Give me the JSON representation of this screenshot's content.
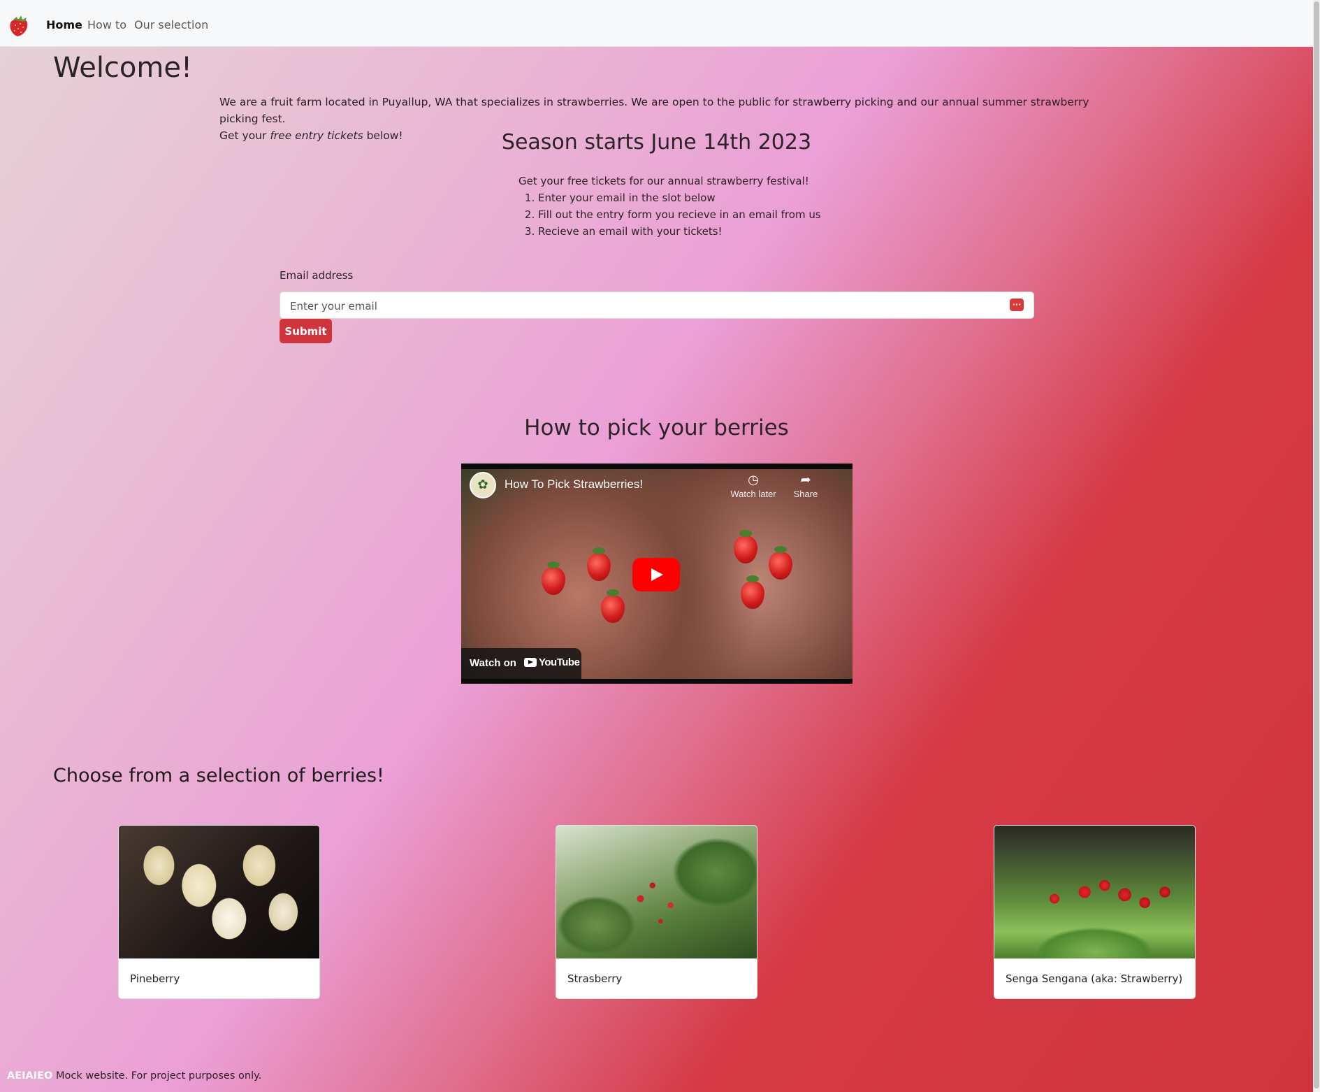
{
  "nav": {
    "links": [
      "Home",
      "How to",
      "Our selection"
    ],
    "active": "Home"
  },
  "welcome": {
    "title": "Welcome!",
    "intro_line1": "We are a fruit farm located in Puyallup, WA that specializes in strawberries. We are open to the public for strawberry picking and our annual summer strawberry picking fest.",
    "intro_line2_before": "Get your ",
    "intro_line2_emphasis": "free entry tickets",
    "intro_line2_after": " below!"
  },
  "season": {
    "title": "Season starts June 14th 2023",
    "lead": "Get your free tickets for our annual strawberry festival!",
    "steps": [
      "Enter your email in the slot below",
      "Fill out the entry form you recieve in an email from us",
      "Recieve an email with your tickets!"
    ]
  },
  "form": {
    "email_label": "Email address",
    "email_placeholder": "Enter your email",
    "email_value": "",
    "submit_label": "Submit"
  },
  "howto": {
    "title": "How to pick your berries",
    "video": {
      "title": "How To Pick Strawberries!",
      "watch_later_label": "Watch later",
      "share_label": "Share",
      "watch_on_label": "Watch on",
      "platform_label": "YouTube"
    }
  },
  "selection": {
    "title": "Choose from a selection of berries!",
    "cards": [
      {
        "label": "Pineberry",
        "image": "pineberry-photo"
      },
      {
        "label": "Strasberry",
        "image": "strasberry-photo"
      },
      {
        "label": "Senga Sengana (aka: Strawberry)",
        "image": "senga-sengana-photo"
      }
    ]
  },
  "footer": {
    "brand": "AEIAIEO",
    "text": "Mock website. For project purposes only."
  },
  "colors": {
    "accent": "#cf333c",
    "nav_bg": "#f7f8f9",
    "youtube_red": "#ff0000"
  }
}
